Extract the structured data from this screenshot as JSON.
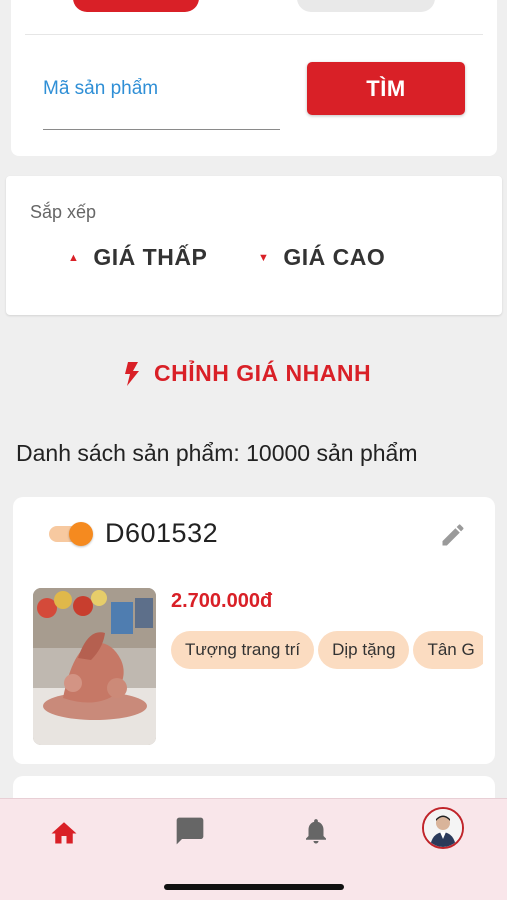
{
  "search": {
    "placeholder": "Mã sản phẩm",
    "value": "",
    "find_label": "TÌM"
  },
  "sort": {
    "label": "Sắp xếp",
    "low_label": "GIÁ THẤP",
    "high_label": "GIÁ CAO"
  },
  "quick_price": {
    "label": "CHỈNH GIÁ NHANH",
    "icon": "lightning-icon"
  },
  "list": {
    "title": "Danh sách sản phẩm: 10000 sản phẩm"
  },
  "product": {
    "code": "D601532",
    "price": "2.700.000đ",
    "enabled": true,
    "tags": [
      "Tượng trang trí",
      "Dịp tặng",
      "Tân G"
    ]
  },
  "nav": {
    "items": [
      "home-icon",
      "chat-icon",
      "bell-icon",
      "avatar"
    ],
    "active": "home-icon"
  },
  "colors": {
    "accent": "#d92027",
    "toggle": "#f58a1f",
    "tag_bg": "#fbdcc1",
    "nav_bg": "#f9e6ea"
  }
}
